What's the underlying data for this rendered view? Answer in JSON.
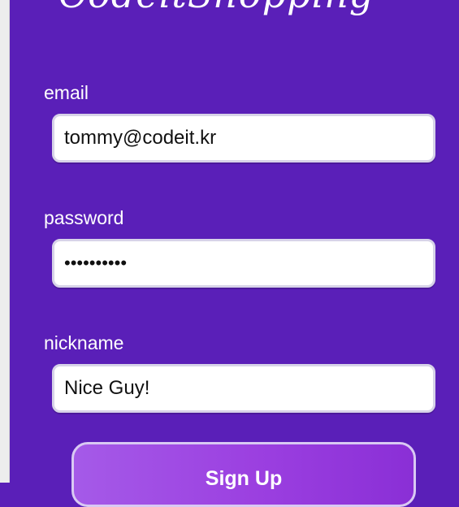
{
  "brand": {
    "logo_text": "CodeitShopping"
  },
  "form": {
    "email": {
      "label": "email",
      "value": "tommy@codeit.kr"
    },
    "password": {
      "label": "password",
      "value": "••••••••••"
    },
    "nickname": {
      "label": "nickname",
      "value": "Nice Guy!"
    },
    "submit_label": "Sign Up"
  },
  "colors": {
    "background": "#5a1fb8",
    "button_gradient_start": "#a55ae8",
    "button_gradient_end": "#8a2fd6"
  }
}
